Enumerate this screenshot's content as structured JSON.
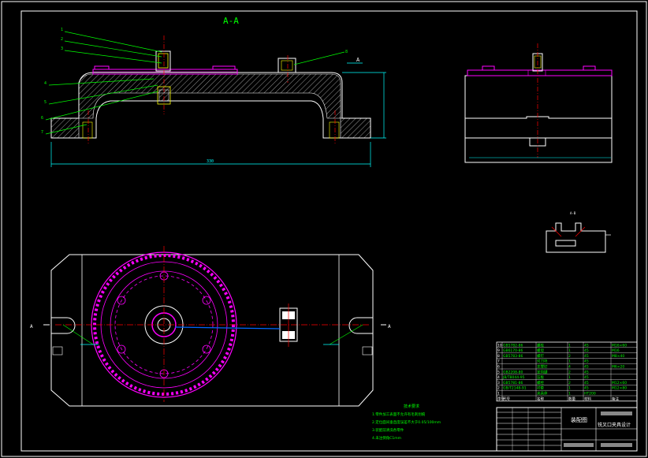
{
  "section_label": "A-A",
  "cut_mark_right_top": "A",
  "cut_mark_left": "A",
  "cut_mark_right": "A",
  "detail_label": "A-B",
  "overall_dim": "330",
  "tech_req": {
    "title": "技术要求",
    "items": [
      "1.零件加工表面不允许有毛刺划痕",
      "2.定位面间垂直度误差不大于0.05/100mm",
      "3.装配前清洗各零件",
      "4.未注倒角C1mm"
    ]
  },
  "title_block": {
    "drawing_name": "装配图",
    "project": "铣叉口夹具设计"
  },
  "bom_rows": [
    {
      "no": "10",
      "code": "GB5782-86",
      "name": "螺栓",
      "qty": "1",
      "mat": "45",
      "note": "M16×60"
    },
    {
      "no": "9",
      "code": "GB6170-86",
      "name": "螺母",
      "qty": "1",
      "mat": "45",
      "note": "M16"
    },
    {
      "no": "8",
      "code": "GB5783-86",
      "name": "螺钉",
      "qty": "2",
      "mat": "45",
      "note": "M8×40"
    },
    {
      "no": "7",
      "code": "",
      "name": "对刀块",
      "qty": "1",
      "mat": "45",
      "note": ""
    },
    {
      "no": "6",
      "code": "",
      "name": "支撑钉",
      "qty": "4",
      "mat": "45",
      "note": "M6×20"
    },
    {
      "no": "5",
      "code": "GB2208-80",
      "name": "定向键",
      "qty": "2",
      "mat": "45",
      "note": ""
    },
    {
      "no": "4",
      "code": "JB/T8044-95",
      "name": "压板",
      "qty": "1",
      "mat": "45",
      "note": ""
    },
    {
      "no": "3",
      "code": "GB5781-86",
      "name": "螺栓",
      "qty": "2",
      "mat": "45",
      "note": "M12×60"
    },
    {
      "no": "2",
      "code": "GB/T2148-91",
      "name": "衬套",
      "qty": "1",
      "mat": "45",
      "note": "M12×80"
    },
    {
      "no": "1",
      "code": "",
      "name": "夹具体",
      "qty": "1",
      "mat": "HT200",
      "note": ""
    }
  ],
  "bom_header": {
    "no": "序号",
    "code": "代号",
    "name": "名称",
    "qty": "数量",
    "mat": "材料",
    "note": "备注"
  }
}
